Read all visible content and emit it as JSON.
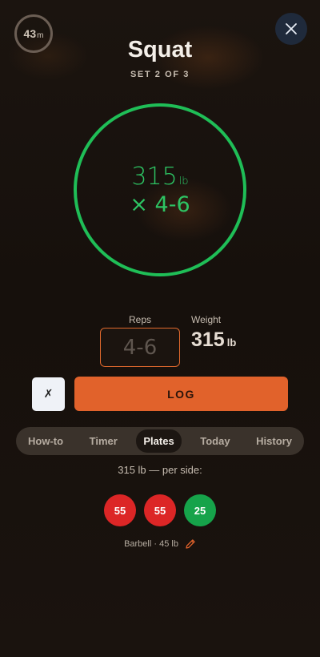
{
  "timer": {
    "value": "43",
    "unit": "m"
  },
  "exercise": {
    "name": "Squat",
    "set_label": "SET 2 OF 3"
  },
  "target": {
    "weight": "315",
    "unit": "lb",
    "reps": "× 4-6"
  },
  "inputs": {
    "reps_label": "Reps",
    "reps_placeholder": "4-6",
    "weight_label": "Weight",
    "weight_value": "315",
    "weight_unit": "lb"
  },
  "actions": {
    "skip_label": "✗",
    "log_label": "LOG"
  },
  "tabs": [
    {
      "label": "How-to"
    },
    {
      "label": "Timer"
    },
    {
      "label": "Plates",
      "active": true
    },
    {
      "label": "Today"
    },
    {
      "label": "History"
    }
  ],
  "plates": {
    "caption": "315 lb — per side:",
    "items": [
      {
        "value": "55",
        "color": "#dc2626"
      },
      {
        "value": "55",
        "color": "#dc2626"
      },
      {
        "value": "25",
        "color": "#16a34a"
      }
    ],
    "barbell_label": "Barbell · 45 lb"
  },
  "colors": {
    "accent": "#e1622b",
    "ring": "#1fbe57",
    "target_text": "#2dc463"
  },
  "icons": {
    "close": "close-icon",
    "edit": "pencil-icon",
    "timer": "timer-ring-icon"
  }
}
